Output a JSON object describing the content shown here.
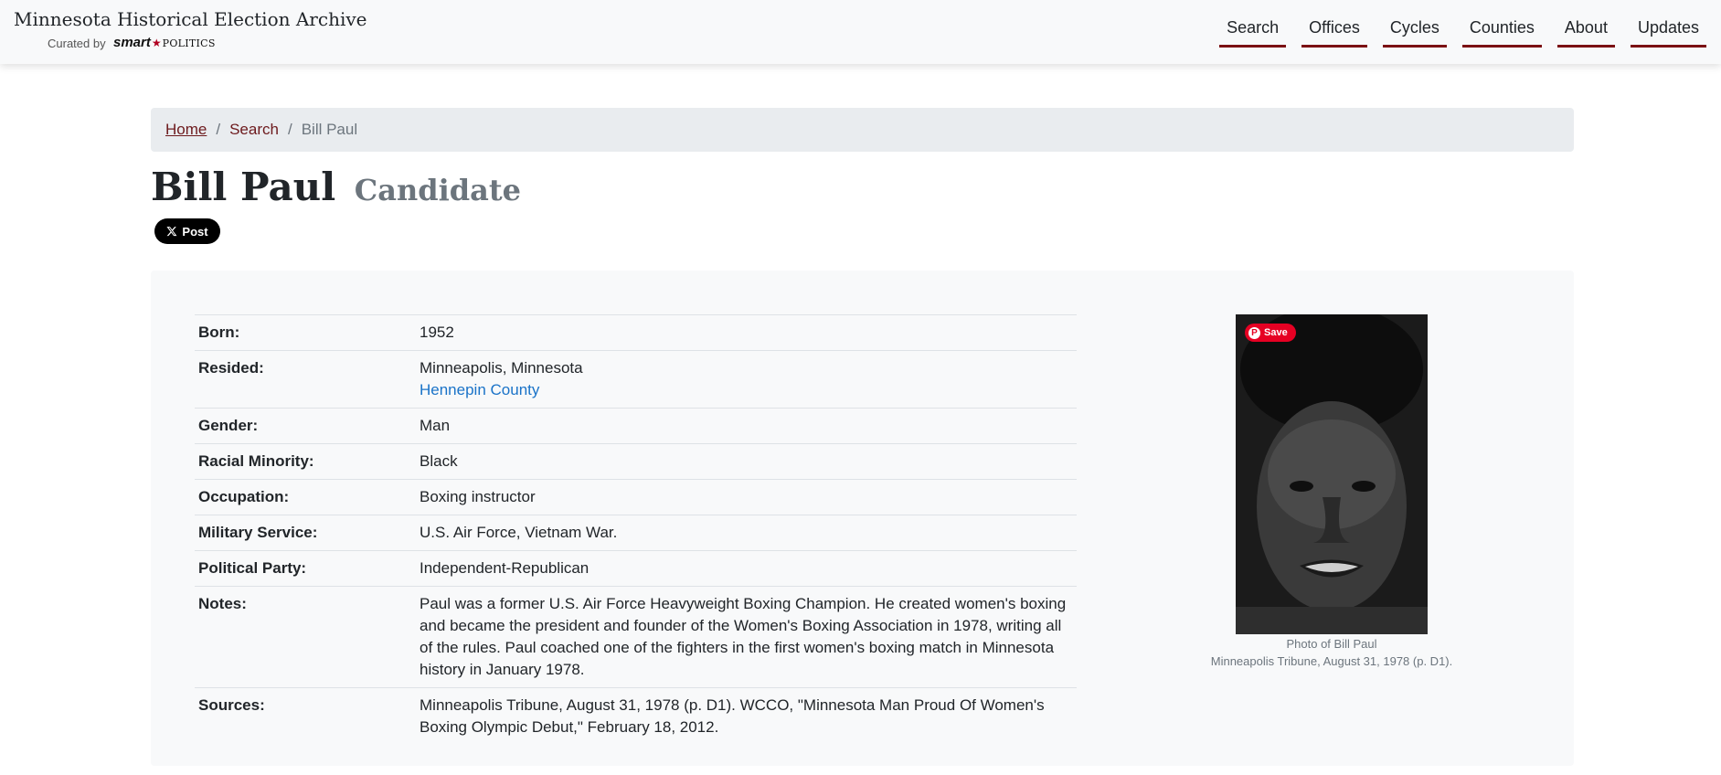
{
  "header": {
    "title": "Minnesota Historical Election Archive",
    "curated_by": "Curated by",
    "logo_smart": "smart",
    "logo_politics": "POLITICS",
    "nav": [
      "Search",
      "Offices",
      "Cycles",
      "Counties",
      "About",
      "Updates"
    ]
  },
  "breadcrumb": {
    "home": "Home",
    "search": "Search",
    "current": "Bill Paul",
    "separator": "/"
  },
  "page": {
    "title": "Bill Paul",
    "subtitle": "Candidate",
    "post_button": "Post"
  },
  "info": {
    "born": {
      "label": "Born:",
      "value": "1952"
    },
    "resided": {
      "label": "Resided:",
      "value": "Minneapolis, Minnesota",
      "county_link": "Hennepin County"
    },
    "gender": {
      "label": "Gender:",
      "value": "Man"
    },
    "racial_minority": {
      "label": "Racial Minority:",
      "value": "Black"
    },
    "occupation": {
      "label": "Occupation:",
      "value": "Boxing instructor"
    },
    "military_service": {
      "label": "Military Service:",
      "value": "U.S. Air Force, Vietnam War."
    },
    "political_party": {
      "label": "Political Party:",
      "value": "Independent-Republican"
    },
    "notes": {
      "label": "Notes:",
      "value": "Paul was a former U.S. Air Force Heavyweight Boxing Champion. He created women's boxing and became the president and founder of the Women's Boxing Association in 1978, writing all of the rules. Paul coached one of the fighters in the first women's boxing match in Minnesota history in January 1978."
    },
    "sources": {
      "label": "Sources:",
      "value": "Minneapolis Tribune, August 31, 1978 (p. D1). WCCO, \"Minnesota Man Proud Of Women's Boxing Olympic Debut,\" February 18, 2012."
    }
  },
  "photo": {
    "save_label": "Save",
    "pin_letter": "P",
    "caption_line1": "Photo of Bill Paul",
    "caption_line2": "Minneapolis Tribune, August 31, 1978 (p. D1)."
  }
}
